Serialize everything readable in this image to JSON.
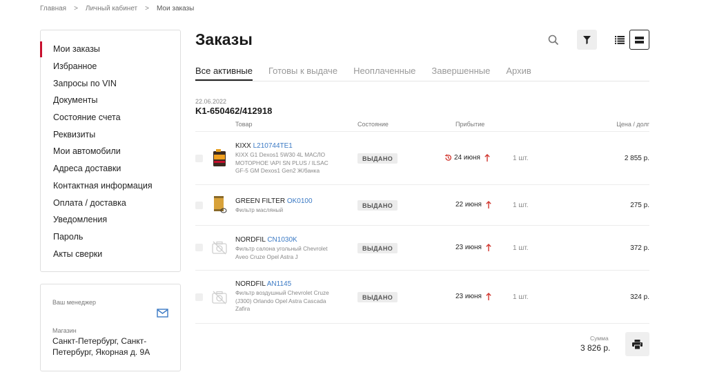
{
  "breadcrumb": {
    "home": "Главная",
    "cabinet": "Личный кабинет",
    "current": "Мои заказы",
    "sep": ">"
  },
  "sidebar": {
    "items": [
      "Мои заказы",
      "Избранное",
      "Запросы по VIN",
      "Документы",
      "Состояние счета",
      "Реквизиты",
      "Мои автомобили",
      "Адреса доставки",
      "Контактная информация",
      "Оплата / доставка",
      "Уведомления",
      "Пароль",
      "Акты сверки"
    ]
  },
  "manager": {
    "label": "Ваш менеджер",
    "store_label": "Магазин",
    "store_address": "Санкт-Петербург, Санкт-Петербург, Якорная д. 9А"
  },
  "page": {
    "title": "Заказы"
  },
  "tabs": [
    "Все активные",
    "Готовы к выдаче",
    "Неоплаченные",
    "Завершенные",
    "Архив"
  ],
  "order": {
    "date": "22.06.2022",
    "number": "K1-650462/412918",
    "headers": {
      "product": "Товар",
      "status": "Состояние",
      "arrival": "Прибытие",
      "price": "Цена / долг"
    },
    "rows": [
      {
        "brand": "KIXX",
        "code": "L210744TE1",
        "desc": "KIXX G1 Dexos1 5W30 4L МАСЛО МОТОРНОЕ \\API SN PLUS / ILSAC GF-5 GM Dexos1 Gen2 Ж/банка",
        "status": "ВЫДАНО",
        "arrival": "24 июня",
        "qty": "1 шт.",
        "price": "2 855 р.",
        "thumb": "oil-can"
      },
      {
        "brand": "GREEN FILTER",
        "code": "OK0100",
        "desc": "Фильтр масляный",
        "status": "ВЫДАНО",
        "arrival": "22 июня",
        "qty": "1 шт.",
        "price": "275 р.",
        "thumb": "oil-filter"
      },
      {
        "brand": "NORDFIL",
        "code": "CN1030K",
        "desc": "Фильтр салона угольный Chevrolet Aveo Cruze Opel Astra J",
        "status": "ВЫДАНО",
        "arrival": "23 июня",
        "qty": "1 шт.",
        "price": "372 р.",
        "thumb": "no-image"
      },
      {
        "brand": "NORDFIL",
        "code": "AN1145",
        "desc": "Фильтр воздушный Chevrolet Cruze (J300) Orlando Opel Astra Cascada Zafira",
        "status": "ВЫДАНО",
        "arrival": "23 июня",
        "qty": "1 шт.",
        "price": "324 р.",
        "thumb": "no-image"
      }
    ],
    "sum_label": "Сумма",
    "sum_value": "3 826 р."
  },
  "colors": {
    "accent": "#c8102e",
    "link": "#3a79c4",
    "arrow": "#d0342c"
  }
}
